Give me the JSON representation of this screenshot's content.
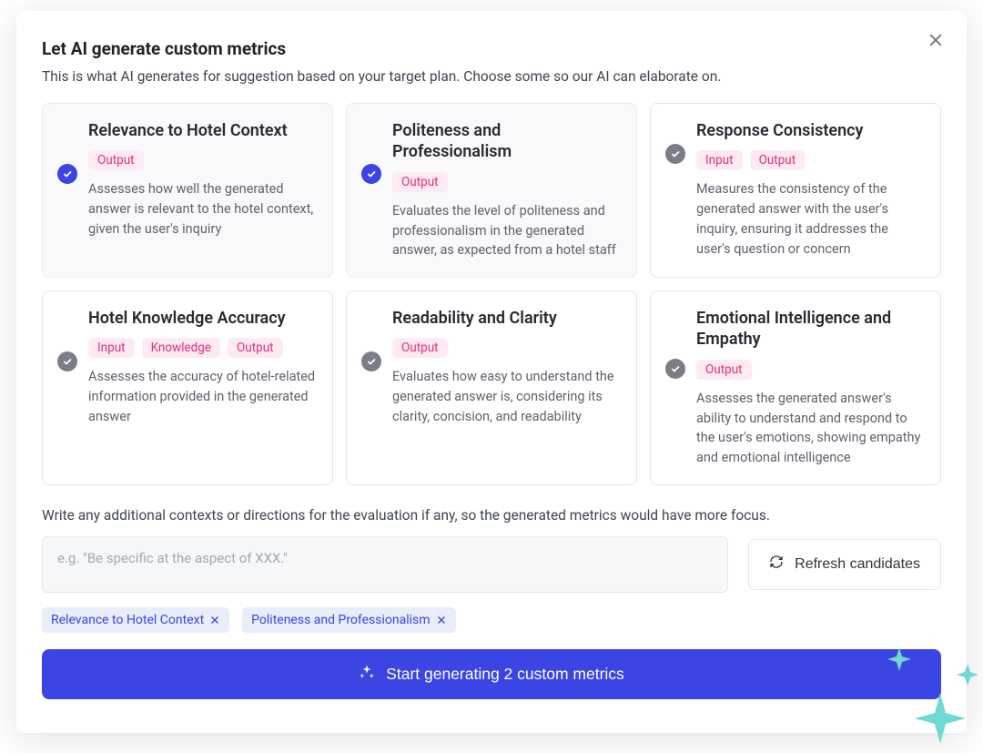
{
  "header": {
    "title": "Let AI generate custom metrics",
    "subtitle": "This is what AI generates for suggestion based on your target plan. Choose some so our AI can elaborate on."
  },
  "cards": [
    {
      "title": "Relevance to Hotel Context",
      "tags": [
        "Output"
      ],
      "description": "Assesses how well the generated answer is relevant to the hotel context, given the user's inquiry",
      "selected": true
    },
    {
      "title": "Politeness and Professionalism",
      "tags": [
        "Output"
      ],
      "description": "Evaluates the level of politeness and professionalism in the generated answer, as expected from a hotel staff",
      "selected": true
    },
    {
      "title": "Response Consistency",
      "tags": [
        "Input",
        "Output"
      ],
      "description": "Measures the consistency of the generated answer with the user's inquiry, ensuring it addresses the user's question or concern",
      "selected": false
    },
    {
      "title": "Hotel Knowledge Accuracy",
      "tags": [
        "Input",
        "Knowledge",
        "Output"
      ],
      "description": "Assesses the accuracy of hotel-related information provided in the generated answer",
      "selected": false
    },
    {
      "title": "Readability and Clarity",
      "tags": [
        "Output"
      ],
      "description": "Evaluates how easy to understand the generated answer is, considering its clarity, concision, and readability",
      "selected": false
    },
    {
      "title": "Emotional Intelligence and Empathy",
      "tags": [
        "Output"
      ],
      "description": "Assesses the generated answer's ability to understand and respond to the user's emotions, showing empathy and emotional intelligence",
      "selected": false
    }
  ],
  "context": {
    "label": "Write any additional contexts or directions for the evaluation if any, so the generated metrics would have more focus.",
    "placeholder": "e.g. \"Be specific at the aspect of XXX.\"",
    "value": ""
  },
  "refresh_label": "Refresh candidates",
  "chips": [
    "Relevance to Hotel Context",
    "Politeness and Professionalism"
  ],
  "start_button_label": "Start generating 2 custom metrics",
  "colors": {
    "accent": "#3a45e4",
    "tag_bg": "#fdeaf2",
    "tag_fg": "#e72c7a",
    "sparkle": "#6fd9d4"
  }
}
